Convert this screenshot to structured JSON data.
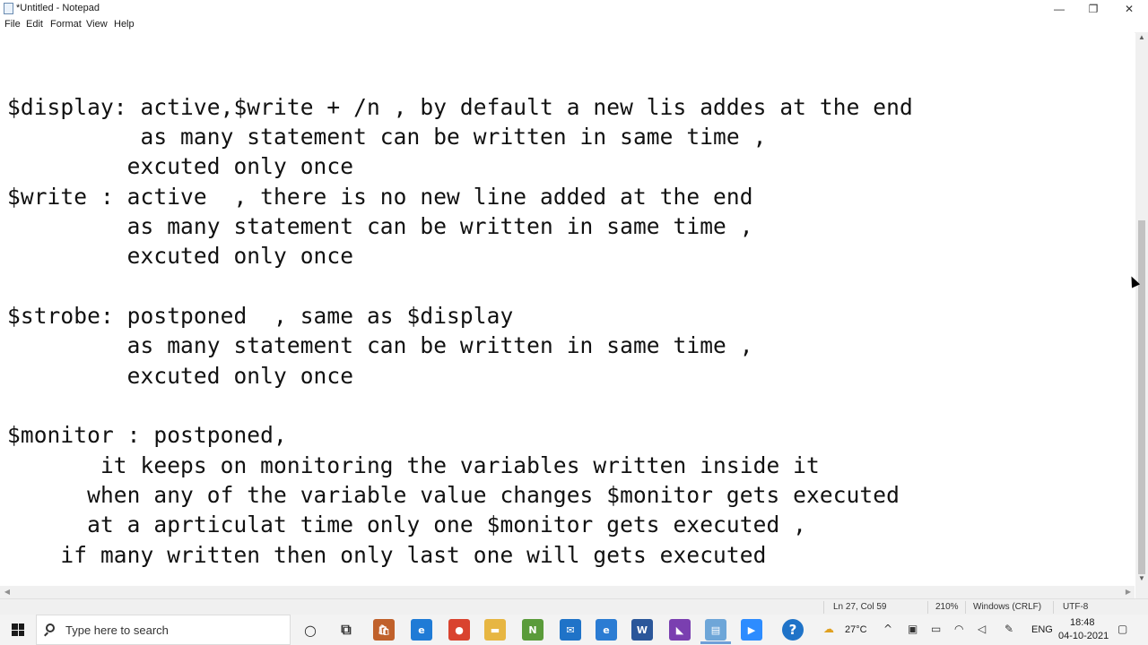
{
  "window": {
    "title": "*Untitled - Notepad",
    "minimize_glyph": "—",
    "maximize_glyph": "❐",
    "close_glyph": "✕"
  },
  "menu": [
    "File",
    "Edit",
    "Format",
    "View",
    "Help"
  ],
  "editor": {
    "lines": [
      "$display: active,$write + /n , by default a new lis addes at the end",
      "          as many statement can be written in same time ,",
      "         excuted only once",
      "$write : active  , there is no new line added at the end",
      "         as many statement can be written in same time ,",
      "         excuted only once",
      "",
      "$strobe: postponed  , same as $display",
      "         as many statement can be written in same time ,",
      "         excuted only once",
      "",
      "$monitor : postponed,",
      "       it keeps on monitoring the variables written inside it",
      "      when any of the variable value changes $monitor gets executed",
      "      at a aprticulat time only one $monitor gets executed ,",
      "    if many written then only last one will gets executed"
    ]
  },
  "status": {
    "position": "Ln 27, Col 59",
    "zoom": "210%",
    "line_ending": "Windows (CRLF)",
    "encoding": "UTF-8"
  },
  "taskbar": {
    "search_placeholder": "Type here to search",
    "apps": [
      {
        "icon": "cortana-icon",
        "glyph": "○",
        "color": "#333333"
      },
      {
        "icon": "task-view-icon",
        "glyph": "⧉",
        "color": "#333333"
      },
      {
        "icon": "store-icon",
        "glyph": "🛍",
        "color": "#c0612b"
      },
      {
        "icon": "edge-icon",
        "glyph": "e",
        "color": "#1f7bd6"
      },
      {
        "icon": "chrome-icon",
        "glyph": "●",
        "color": "#d9432f"
      },
      {
        "icon": "file-explorer-icon",
        "glyph": "▬",
        "color": "#e7b642"
      },
      {
        "icon": "notepad-plus-icon",
        "glyph": "N",
        "color": "#5a9b3a"
      },
      {
        "icon": "mail-icon",
        "glyph": "✉",
        "color": "#1f73c8"
      },
      {
        "icon": "internet-explorer-icon",
        "glyph": "e",
        "color": "#2b7cd3"
      },
      {
        "icon": "word-icon",
        "glyph": "W",
        "color": "#2b579a"
      },
      {
        "icon": "visual-studio-icon",
        "glyph": "◣",
        "color": "#7a3fb0"
      },
      {
        "icon": "notepad-icon",
        "glyph": "▤",
        "color": "#6ea6d8"
      },
      {
        "icon": "zoom-icon",
        "glyph": "▶",
        "color": "#2d8cff"
      },
      {
        "icon": "help-icon",
        "glyph": "?",
        "color": "#1f73c8"
      }
    ],
    "weather": "27°C",
    "language": "ENG",
    "time": "18:48",
    "date": "04-10-2021"
  }
}
